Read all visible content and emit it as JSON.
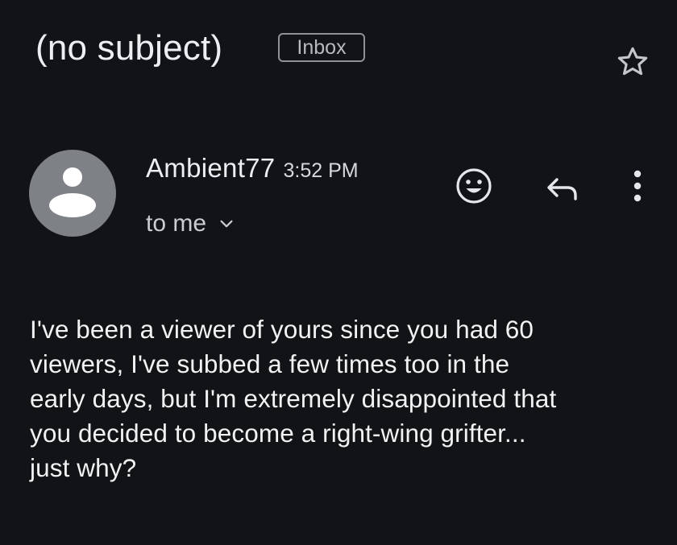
{
  "email": {
    "subject": "(no subject)",
    "label": "Inbox",
    "sender": {
      "name": "Ambient77",
      "time": "3:52 PM",
      "recipient": "to me"
    },
    "body": "I've been a viewer of yours since you had 60\nviewers, I've subbed a few times too in the\nearly days, but I'm extremely disappointed that\nyou decided to become a right-wing grifter...\njust why?"
  },
  "icons": {
    "star": "star-outline-icon",
    "avatar": "default-user-avatar-icon",
    "recipient_toggle": "chevron-down-icon",
    "react": "smiley-face-icon",
    "reply": "reply-arrow-icon",
    "more": "more-vertical-icon"
  },
  "colors": {
    "background": "#121316",
    "text_primary": "#eceef1",
    "text_secondary": "#c9ccd0",
    "avatar_bg": "#7e8186",
    "badge_border": "#8e9196"
  }
}
